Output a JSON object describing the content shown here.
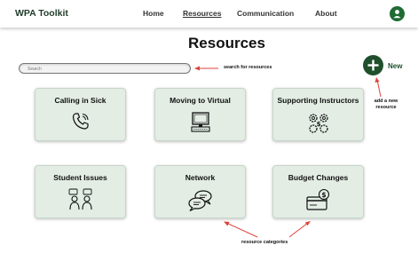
{
  "header": {
    "brand": "WPA Toolkit",
    "nav": [
      "Home",
      "Resources",
      "Communication",
      "About"
    ],
    "active": "Resources"
  },
  "page": {
    "title": "Resources"
  },
  "search": {
    "placeholder": "Search"
  },
  "add": {
    "label": "New"
  },
  "cards": [
    {
      "label": "Calling in Sick",
      "icon": "phone-icon"
    },
    {
      "label": "Moving to Virtual",
      "icon": "computer-icon"
    },
    {
      "label": "Supporting Instructors",
      "icon": "gears-dollar-icon"
    },
    {
      "label": "Student Issues",
      "icon": "people-chat-icon"
    },
    {
      "label": "Network",
      "icon": "chat-bubbles-icon"
    },
    {
      "label": "Budget Changes",
      "icon": "credit-card-dollar-icon"
    }
  ],
  "annotations": {
    "search": "search for resources",
    "add": "add a new resource",
    "categories": "resource categories"
  },
  "colors": {
    "accent": "#1f4f2c",
    "card_bg": "#e3ede4",
    "annotation_arrow": "#e0433a"
  }
}
